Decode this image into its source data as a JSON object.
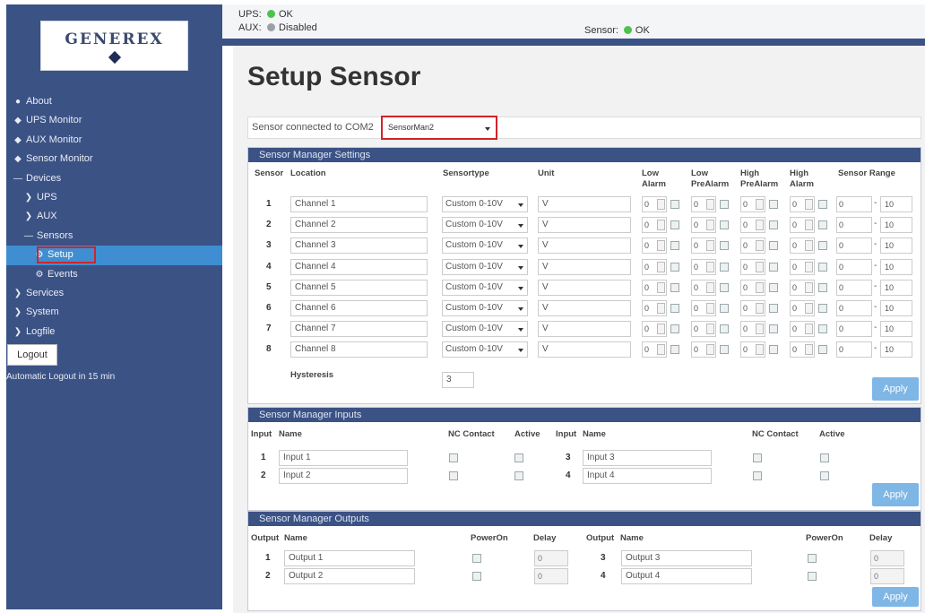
{
  "status": {
    "ups_label": "UPS:",
    "ups_value": "OK",
    "aux_label": "AUX:",
    "aux_value": "Disabled",
    "sensor_label": "Sensor:",
    "sensor_value": "OK",
    "colors": {
      "ok": "#4fc14f",
      "disabled": "#9aa0a6"
    }
  },
  "logo": {
    "text": "GENEREX"
  },
  "sidebar": {
    "items": [
      {
        "label": "About",
        "icon": "info-icon"
      },
      {
        "label": "UPS Monitor",
        "icon": "dashboard-icon"
      },
      {
        "label": "AUX Monitor",
        "icon": "dashboard-icon"
      },
      {
        "label": "Sensor Monitor",
        "icon": "dashboard-icon"
      },
      {
        "label": "Devices",
        "icon": "minus-icon"
      },
      {
        "label": "UPS",
        "icon": "chevron-right-icon"
      },
      {
        "label": "AUX",
        "icon": "chevron-right-icon"
      },
      {
        "label": "Sensors",
        "icon": "minus-icon"
      },
      {
        "label": "Setup",
        "icon": "gear-icon",
        "active": true
      },
      {
        "label": "Events",
        "icon": "gear-icon"
      },
      {
        "label": "Services",
        "icon": "chevron-right-icon"
      },
      {
        "label": "System",
        "icon": "chevron-right-icon"
      },
      {
        "label": "Logfile",
        "icon": "chevron-right-icon"
      }
    ],
    "logout_label": "Logout",
    "auto_logout": "Automatic Logout in 15 min"
  },
  "page": {
    "title": "Setup Sensor",
    "sensor_connected_label": "Sensor connected to COM2",
    "sensor_select_value": "SensorMan2"
  },
  "settings": {
    "title": "Sensor Manager Settings",
    "headers": {
      "sensor": "Sensor",
      "location": "Location",
      "sensortype": "Sensortype",
      "unit": "Unit",
      "low_alarm_1": "Low",
      "low_alarm_2": "Alarm",
      "low_prealarm_1": "Low",
      "low_prealarm_2": "PreAlarm",
      "high_prealarm_1": "High",
      "high_prealarm_2": "PreAlarm",
      "high_alarm_1": "High",
      "high_alarm_2": "Alarm",
      "range": "Sensor Range"
    },
    "rows": [
      {
        "num": "1",
        "location": "Channel 1",
        "type": "Custom 0-10V",
        "unit": "V",
        "la": "0",
        "lpa": "0",
        "hpa": "0",
        "ha": "0",
        "rmin": "0",
        "rmax": "10"
      },
      {
        "num": "2",
        "location": "Channel 2",
        "type": "Custom 0-10V",
        "unit": "V",
        "la": "0",
        "lpa": "0",
        "hpa": "0",
        "ha": "0",
        "rmin": "0",
        "rmax": "10"
      },
      {
        "num": "3",
        "location": "Channel 3",
        "type": "Custom 0-10V",
        "unit": "V",
        "la": "0",
        "lpa": "0",
        "hpa": "0",
        "ha": "0",
        "rmin": "0",
        "rmax": "10"
      },
      {
        "num": "4",
        "location": "Channel 4",
        "type": "Custom 0-10V",
        "unit": "V",
        "la": "0",
        "lpa": "0",
        "hpa": "0",
        "ha": "0",
        "rmin": "0",
        "rmax": "10"
      },
      {
        "num": "5",
        "location": "Channel 5",
        "type": "Custom 0-10V",
        "unit": "V",
        "la": "0",
        "lpa": "0",
        "hpa": "0",
        "ha": "0",
        "rmin": "0",
        "rmax": "10"
      },
      {
        "num": "6",
        "location": "Channel 6",
        "type": "Custom 0-10V",
        "unit": "V",
        "la": "0",
        "lpa": "0",
        "hpa": "0",
        "ha": "0",
        "rmin": "0",
        "rmax": "10"
      },
      {
        "num": "7",
        "location": "Channel 7",
        "type": "Custom 0-10V",
        "unit": "V",
        "la": "0",
        "lpa": "0",
        "hpa": "0",
        "ha": "0",
        "rmin": "0",
        "rmax": "10"
      },
      {
        "num": "8",
        "location": "Channel 8",
        "type": "Custom 0-10V",
        "unit": "V",
        "la": "0",
        "lpa": "0",
        "hpa": "0",
        "ha": "0",
        "rmin": "0",
        "rmax": "10"
      }
    ],
    "hysteresis_label": "Hysteresis",
    "hysteresis_value": "3",
    "apply_label": "Apply"
  },
  "inputs": {
    "title": "Sensor Manager Inputs",
    "headers": {
      "input": "Input",
      "name": "Name",
      "nc": "NC Contact",
      "active": "Active"
    },
    "left": [
      {
        "num": "1",
        "name": "Input 1"
      },
      {
        "num": "2",
        "name": "Input 2"
      }
    ],
    "right": [
      {
        "num": "3",
        "name": "Input 3"
      },
      {
        "num": "4",
        "name": "Input 4"
      }
    ],
    "apply_label": "Apply"
  },
  "outputs": {
    "title": "Sensor Manager Outputs",
    "headers": {
      "output": "Output",
      "name": "Name",
      "poweron": "PowerOn",
      "delay": "Delay"
    },
    "left": [
      {
        "num": "1",
        "name": "Output 1",
        "delay": "0"
      },
      {
        "num": "2",
        "name": "Output 2",
        "delay": "0"
      }
    ],
    "right": [
      {
        "num": "3",
        "name": "Output 3",
        "delay": "0"
      },
      {
        "num": "4",
        "name": "Output 4",
        "delay": "0"
      }
    ],
    "apply_label": "Apply"
  }
}
